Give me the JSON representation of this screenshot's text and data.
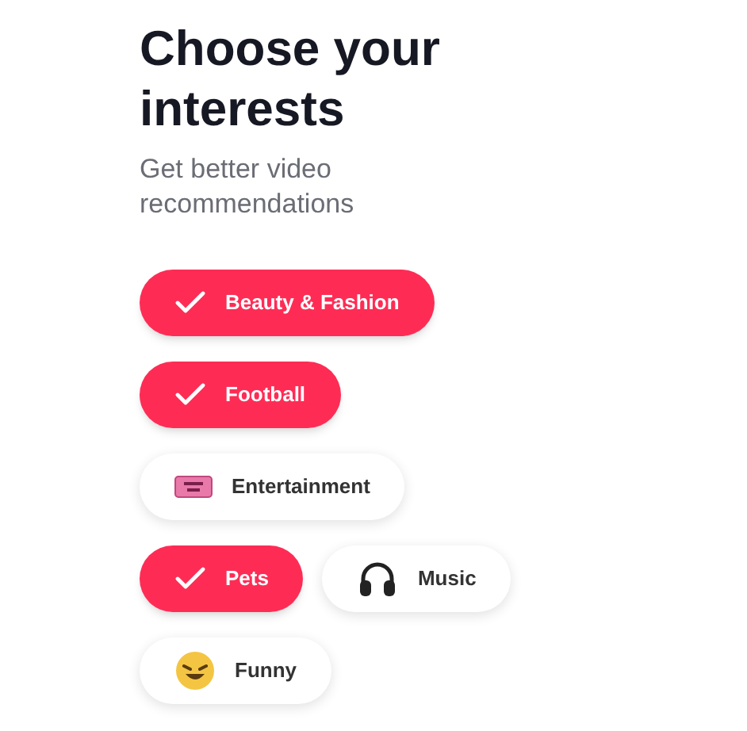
{
  "title": "Choose your interests",
  "subtitle": "Get better video recommendations",
  "rows": [
    {
      "chips": [
        {
          "label": "Beauty & Fashion",
          "selected": true
        }
      ]
    },
    {
      "chips": [
        {
          "label": "Football",
          "selected": true
        }
      ]
    },
    {
      "chips": [
        {
          "label": "Entertainment",
          "selected": false
        }
      ]
    },
    {
      "chips": [
        {
          "label": "Pets",
          "selected": true
        },
        {
          "label": "Music",
          "selected": false
        }
      ]
    },
    {
      "chips": [
        {
          "label": "Funny",
          "selected": false
        }
      ]
    }
  ]
}
